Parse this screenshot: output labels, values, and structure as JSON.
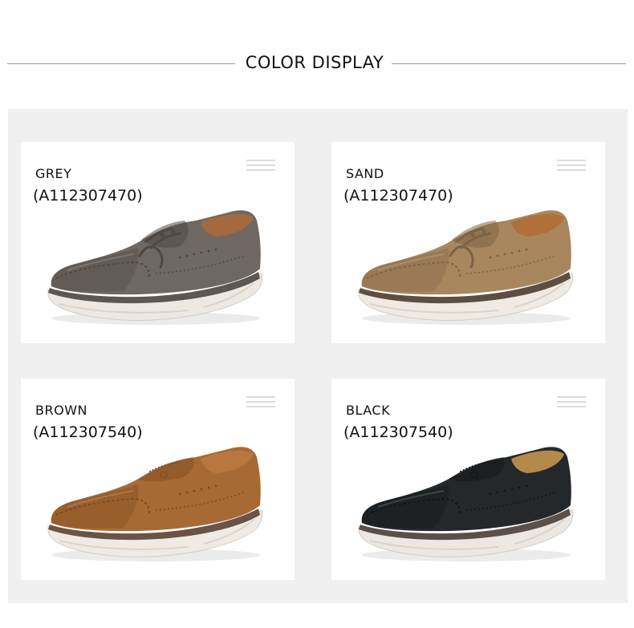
{
  "header": {
    "title": "COLOR DISPLAY"
  },
  "products": [
    {
      "color": "GREY",
      "sku": "(A112307470)",
      "style": "lace-up",
      "upper": "#6f6862",
      "upper_dark": "#4e4843",
      "lining": "#a26a3e",
      "sole_top": "#5e5650",
      "sole": "#ede8e1"
    },
    {
      "color": "SAND",
      "sku": "(A112307470)",
      "style": "lace-up",
      "upper": "#a8875f",
      "upper_dark": "#7d6244",
      "lining": "#b0703a",
      "sole_top": "#5d4e42",
      "sole": "#efeae3"
    },
    {
      "color": "BROWN",
      "sku": "(A112307540)",
      "style": "slip-on",
      "upper": "#a86a34",
      "upper_dark": "#7a4a22",
      "lining": "#b7773e",
      "sole_top": "#6a5446",
      "sole": "#efeae3"
    },
    {
      "color": "BLACK",
      "sku": "(A112307540)",
      "style": "slip-on",
      "upper": "#25282b",
      "upper_dark": "#111315",
      "lining": "#b48a4a",
      "sole_top": "#5a5048",
      "sole": "#ece7e0"
    }
  ]
}
